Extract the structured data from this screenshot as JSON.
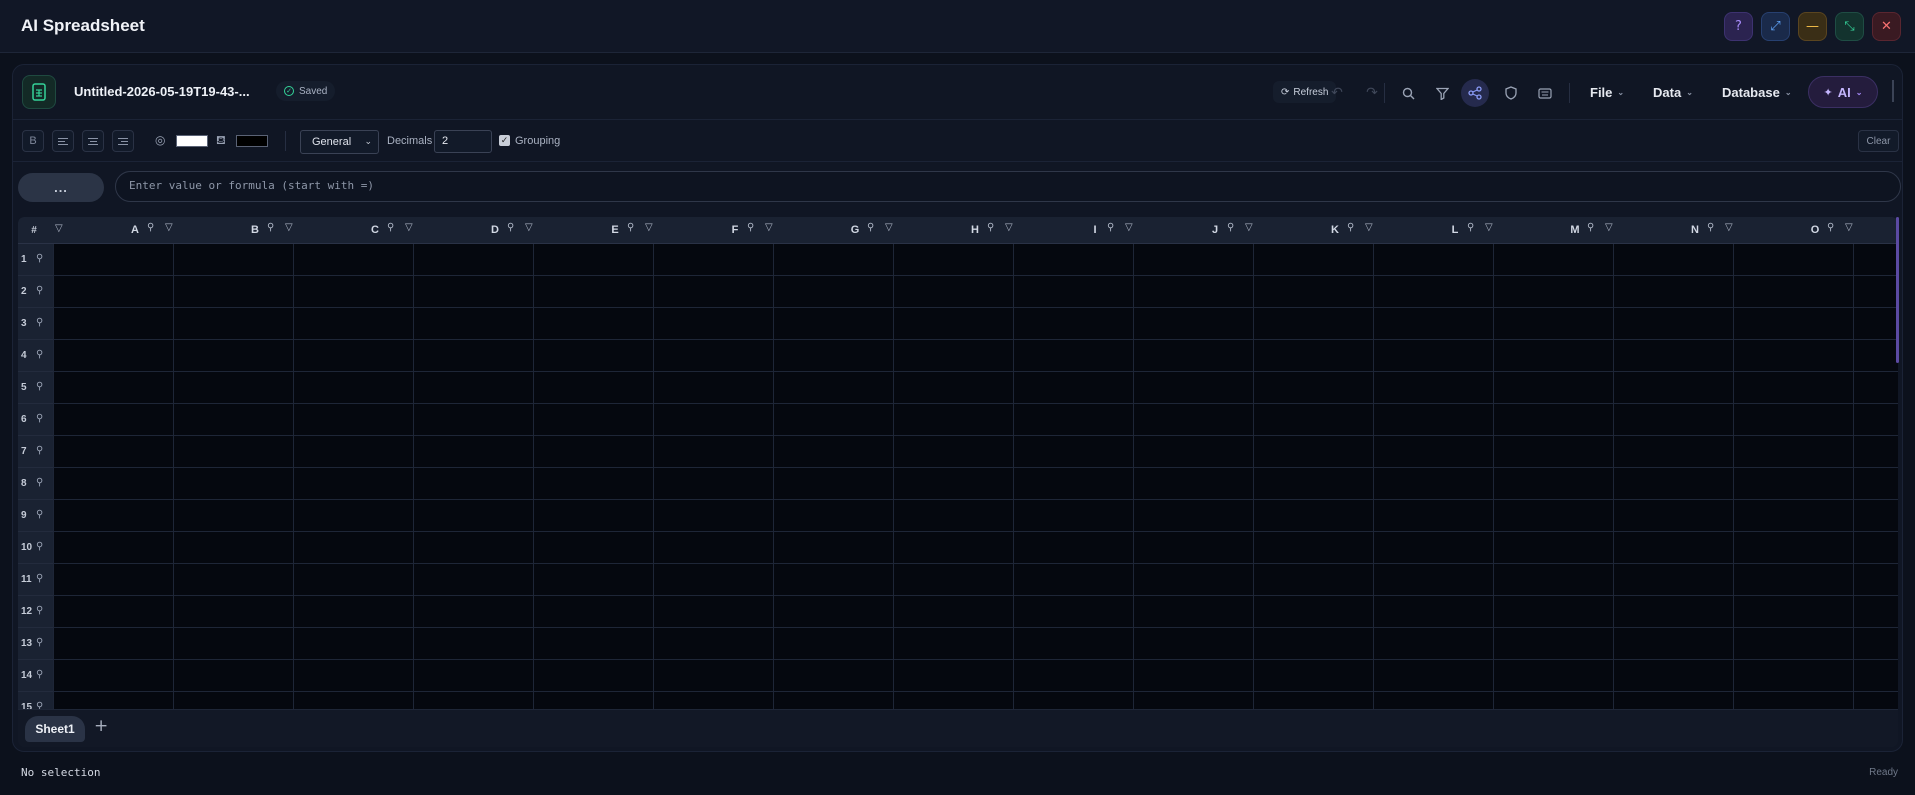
{
  "window": {
    "title": "AI Spreadsheet",
    "buttons": [
      "help-icon",
      "maximize-icon",
      "minimize-icon",
      "fit-icon",
      "close-icon"
    ]
  },
  "toolbar": {
    "document_name": "Untitled-2026-05-19T19-43-...",
    "save_status": "Saved",
    "refresh_label": "Refresh",
    "menus": {
      "file": "File",
      "data": "Data",
      "database": "Database"
    },
    "ai_label": "AI"
  },
  "format": {
    "bold_label": "B",
    "text_color": "#ffffff",
    "fill_color": "#000000",
    "number_format": "General",
    "decimals_label": "Decimals",
    "decimals_value": "2",
    "grouping_label": "Grouping",
    "grouping_checked": true,
    "clear_label": "Clear"
  },
  "formula_bar": {
    "cell_ref": "...",
    "placeholder": "Enter value or formula (start with =)"
  },
  "grid": {
    "corner_label": "#",
    "columns": [
      "A",
      "B",
      "C",
      "D",
      "E",
      "F",
      "G",
      "H",
      "I",
      "J",
      "K",
      "L",
      "M",
      "N",
      "O"
    ],
    "rows": [
      "1",
      "2",
      "3",
      "4",
      "5",
      "6",
      "7",
      "8",
      "9",
      "10",
      "11",
      "12",
      "13",
      "14",
      "15"
    ]
  },
  "sheets": {
    "tabs": [
      "Sheet1"
    ],
    "add_label": "+"
  },
  "status": {
    "selection": "No selection",
    "state": "Ready"
  },
  "colors": {
    "accent": "#8b5cf6",
    "background": "#0c111c",
    "success": "#34d399"
  }
}
